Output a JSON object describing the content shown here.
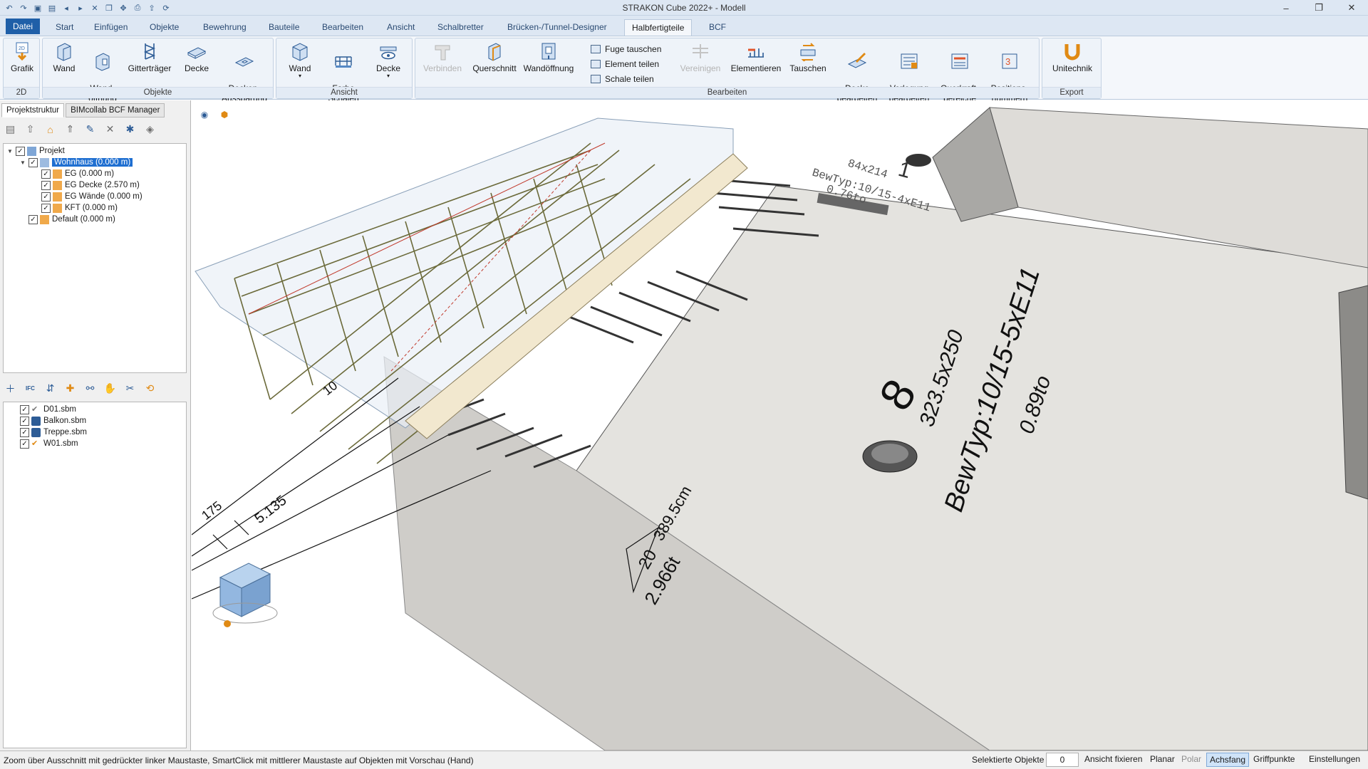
{
  "window": {
    "title": "STRAKON Cube 2022+ - Modell",
    "quick_access_icons": [
      "undo-icon",
      "redo-icon",
      "save-icon",
      "save-as-icon",
      "back-icon",
      "forward-icon",
      "delete-icon",
      "copy-icon",
      "move-icon",
      "print-icon",
      "export-icon",
      "refresh-icon"
    ],
    "controls": [
      "minimize",
      "restore",
      "close"
    ]
  },
  "ribbon": {
    "tabs": [
      {
        "label": "Datei"
      },
      {
        "label": "Start"
      },
      {
        "label": "Einfügen"
      },
      {
        "label": "Objekte"
      },
      {
        "label": "Bewehrung"
      },
      {
        "label": "Bauteile"
      },
      {
        "label": "Bearbeiten"
      },
      {
        "label": "Ansicht"
      },
      {
        "label": "Schalbretter"
      },
      {
        "label": "Brücken-/Tunnel-Designer"
      },
      {
        "label": "Halbfertigteile"
      },
      {
        "label": "BCF"
      }
    ],
    "active_tab": "Halbfertigteile",
    "groups": {
      "g2d": {
        "label": "2D",
        "buttons": [
          {
            "label": "Grafik"
          }
        ]
      },
      "objekte": {
        "label": "Objekte",
        "buttons": [
          {
            "label": "Wand"
          },
          {
            "label": "Wand-\nöffnung"
          },
          {
            "label": "Gitterträger"
          },
          {
            "label": "Decke"
          },
          {
            "label": "Decken-\nAussparung"
          }
        ]
      },
      "ansicht": {
        "label": "Ansicht",
        "buttons": [
          {
            "label": "Wand"
          },
          {
            "label": "Farbe\nSchalen"
          },
          {
            "label": "Decke"
          }
        ]
      },
      "bearbeiten": {
        "label": "Bearbeiten",
        "buttons": [
          {
            "label": "Verbinden",
            "disabled": true
          },
          {
            "label": "Querschnitt"
          },
          {
            "label": "Wandöffnung"
          },
          {
            "label": "Vereinigen",
            "disabled": true
          },
          {
            "label": "Elementieren"
          },
          {
            "label": "Tauschen"
          },
          {
            "label": "Decke\nbearbeiten"
          },
          {
            "label": "Verlegung\nbearbeiten"
          },
          {
            "label": "Querkraft-\nbereiche"
          },
          {
            "label": "Positions-\nnummern"
          }
        ],
        "small": [
          {
            "label": "Fuge tauschen"
          },
          {
            "label": "Element teilen"
          },
          {
            "label": "Schale teilen"
          }
        ]
      },
      "export": {
        "label": "Export",
        "buttons": [
          {
            "label": "Unitechnik"
          }
        ]
      }
    }
  },
  "left_panel": {
    "tabs": [
      {
        "label": "Projektstruktur"
      },
      {
        "label": "BIMcollab BCF Manager"
      }
    ],
    "tree": [
      {
        "label": "Projekt",
        "checked": true,
        "level": 0
      },
      {
        "label": "Wohnhaus (0.000 m)",
        "checked": true,
        "level": 1,
        "selected": true
      },
      {
        "label": "EG (0.000 m)",
        "checked": true,
        "level": 2
      },
      {
        "label": "EG Decke (2.570 m)",
        "checked": true,
        "level": 2
      },
      {
        "label": "EG Wände (0.000 m)",
        "checked": true,
        "level": 2
      },
      {
        "label": "KFT (0.000 m)",
        "checked": true,
        "level": 2
      },
      {
        "label": "Default (0.000 m)",
        "checked": true,
        "level": 1
      }
    ],
    "files": [
      {
        "label": "D01.sbm",
        "checked": true
      },
      {
        "label": "Balkon.sbm",
        "checked": true
      },
      {
        "label": "Treppe.sbm",
        "checked": true
      },
      {
        "label": "W01.sbm",
        "checked": true
      }
    ],
    "ifc_label": "IFC"
  },
  "viewport": {
    "labels": {
      "elem_no": "8",
      "elem_dim": "323.5x250",
      "elem_type": "BewTyp:10/15-5xE11",
      "elem_weight": "0.89to",
      "elem2_no": "1",
      "elem2_type": "BewTyp:10/15-4xE11",
      "elem2_dim": "84x214",
      "elem2_weight": "0.76to",
      "dim1": "5.135",
      "dim2": "175",
      "dim3": "389.5cm",
      "dim4": "20",
      "dim5": "2.966t",
      "dim6": "10"
    }
  },
  "status": {
    "message": "Zoom über Ausschnitt mit gedrückter linker Maustaste, SmartClick mit mittlerer Maustaste auf Objekten mit Vorschau (Hand)",
    "selected_label": "Selektierte Objekte",
    "selected_count": "0",
    "buttons": [
      {
        "label": "Ansicht fixieren",
        "state": "normal"
      },
      {
        "label": "Planar",
        "state": "normal"
      },
      {
        "label": "Polar",
        "state": "off"
      },
      {
        "label": "Achsfang",
        "state": "on"
      },
      {
        "label": "Griffpunkte",
        "state": "normal"
      },
      {
        "label": "Einstellungen",
        "state": "normal"
      }
    ]
  }
}
